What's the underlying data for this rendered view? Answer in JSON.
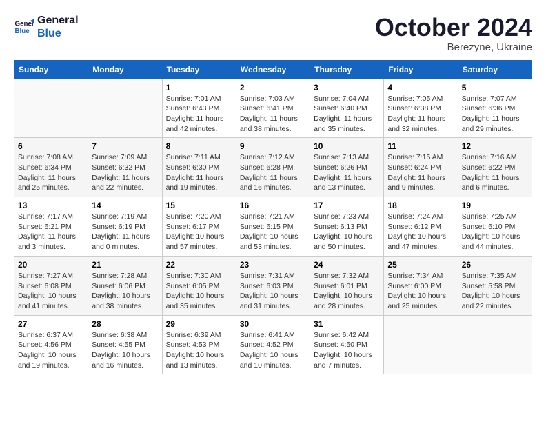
{
  "logo": {
    "line1": "General",
    "line2": "Blue"
  },
  "title": "October 2024",
  "subtitle": "Berezyne, Ukraine",
  "days_header": [
    "Sunday",
    "Monday",
    "Tuesday",
    "Wednesday",
    "Thursday",
    "Friday",
    "Saturday"
  ],
  "weeks": [
    [
      {
        "day": "",
        "info": ""
      },
      {
        "day": "",
        "info": ""
      },
      {
        "day": "1",
        "info": "Sunrise: 7:01 AM\nSunset: 6:43 PM\nDaylight: 11 hours and 42 minutes."
      },
      {
        "day": "2",
        "info": "Sunrise: 7:03 AM\nSunset: 6:41 PM\nDaylight: 11 hours and 38 minutes."
      },
      {
        "day": "3",
        "info": "Sunrise: 7:04 AM\nSunset: 6:40 PM\nDaylight: 11 hours and 35 minutes."
      },
      {
        "day": "4",
        "info": "Sunrise: 7:05 AM\nSunset: 6:38 PM\nDaylight: 11 hours and 32 minutes."
      },
      {
        "day": "5",
        "info": "Sunrise: 7:07 AM\nSunset: 6:36 PM\nDaylight: 11 hours and 29 minutes."
      }
    ],
    [
      {
        "day": "6",
        "info": "Sunrise: 7:08 AM\nSunset: 6:34 PM\nDaylight: 11 hours and 25 minutes."
      },
      {
        "day": "7",
        "info": "Sunrise: 7:09 AM\nSunset: 6:32 PM\nDaylight: 11 hours and 22 minutes."
      },
      {
        "day": "8",
        "info": "Sunrise: 7:11 AM\nSunset: 6:30 PM\nDaylight: 11 hours and 19 minutes."
      },
      {
        "day": "9",
        "info": "Sunrise: 7:12 AM\nSunset: 6:28 PM\nDaylight: 11 hours and 16 minutes."
      },
      {
        "day": "10",
        "info": "Sunrise: 7:13 AM\nSunset: 6:26 PM\nDaylight: 11 hours and 13 minutes."
      },
      {
        "day": "11",
        "info": "Sunrise: 7:15 AM\nSunset: 6:24 PM\nDaylight: 11 hours and 9 minutes."
      },
      {
        "day": "12",
        "info": "Sunrise: 7:16 AM\nSunset: 6:22 PM\nDaylight: 11 hours and 6 minutes."
      }
    ],
    [
      {
        "day": "13",
        "info": "Sunrise: 7:17 AM\nSunset: 6:21 PM\nDaylight: 11 hours and 3 minutes."
      },
      {
        "day": "14",
        "info": "Sunrise: 7:19 AM\nSunset: 6:19 PM\nDaylight: 11 hours and 0 minutes."
      },
      {
        "day": "15",
        "info": "Sunrise: 7:20 AM\nSunset: 6:17 PM\nDaylight: 10 hours and 57 minutes."
      },
      {
        "day": "16",
        "info": "Sunrise: 7:21 AM\nSunset: 6:15 PM\nDaylight: 10 hours and 53 minutes."
      },
      {
        "day": "17",
        "info": "Sunrise: 7:23 AM\nSunset: 6:13 PM\nDaylight: 10 hours and 50 minutes."
      },
      {
        "day": "18",
        "info": "Sunrise: 7:24 AM\nSunset: 6:12 PM\nDaylight: 10 hours and 47 minutes."
      },
      {
        "day": "19",
        "info": "Sunrise: 7:25 AM\nSunset: 6:10 PM\nDaylight: 10 hours and 44 minutes."
      }
    ],
    [
      {
        "day": "20",
        "info": "Sunrise: 7:27 AM\nSunset: 6:08 PM\nDaylight: 10 hours and 41 minutes."
      },
      {
        "day": "21",
        "info": "Sunrise: 7:28 AM\nSunset: 6:06 PM\nDaylight: 10 hours and 38 minutes."
      },
      {
        "day": "22",
        "info": "Sunrise: 7:30 AM\nSunset: 6:05 PM\nDaylight: 10 hours and 35 minutes."
      },
      {
        "day": "23",
        "info": "Sunrise: 7:31 AM\nSunset: 6:03 PM\nDaylight: 10 hours and 31 minutes."
      },
      {
        "day": "24",
        "info": "Sunrise: 7:32 AM\nSunset: 6:01 PM\nDaylight: 10 hours and 28 minutes."
      },
      {
        "day": "25",
        "info": "Sunrise: 7:34 AM\nSunset: 6:00 PM\nDaylight: 10 hours and 25 minutes."
      },
      {
        "day": "26",
        "info": "Sunrise: 7:35 AM\nSunset: 5:58 PM\nDaylight: 10 hours and 22 minutes."
      }
    ],
    [
      {
        "day": "27",
        "info": "Sunrise: 6:37 AM\nSunset: 4:56 PM\nDaylight: 10 hours and 19 minutes."
      },
      {
        "day": "28",
        "info": "Sunrise: 6:38 AM\nSunset: 4:55 PM\nDaylight: 10 hours and 16 minutes."
      },
      {
        "day": "29",
        "info": "Sunrise: 6:39 AM\nSunset: 4:53 PM\nDaylight: 10 hours and 13 minutes."
      },
      {
        "day": "30",
        "info": "Sunrise: 6:41 AM\nSunset: 4:52 PM\nDaylight: 10 hours and 10 minutes."
      },
      {
        "day": "31",
        "info": "Sunrise: 6:42 AM\nSunset: 4:50 PM\nDaylight: 10 hours and 7 minutes."
      },
      {
        "day": "",
        "info": ""
      },
      {
        "day": "",
        "info": ""
      }
    ]
  ]
}
